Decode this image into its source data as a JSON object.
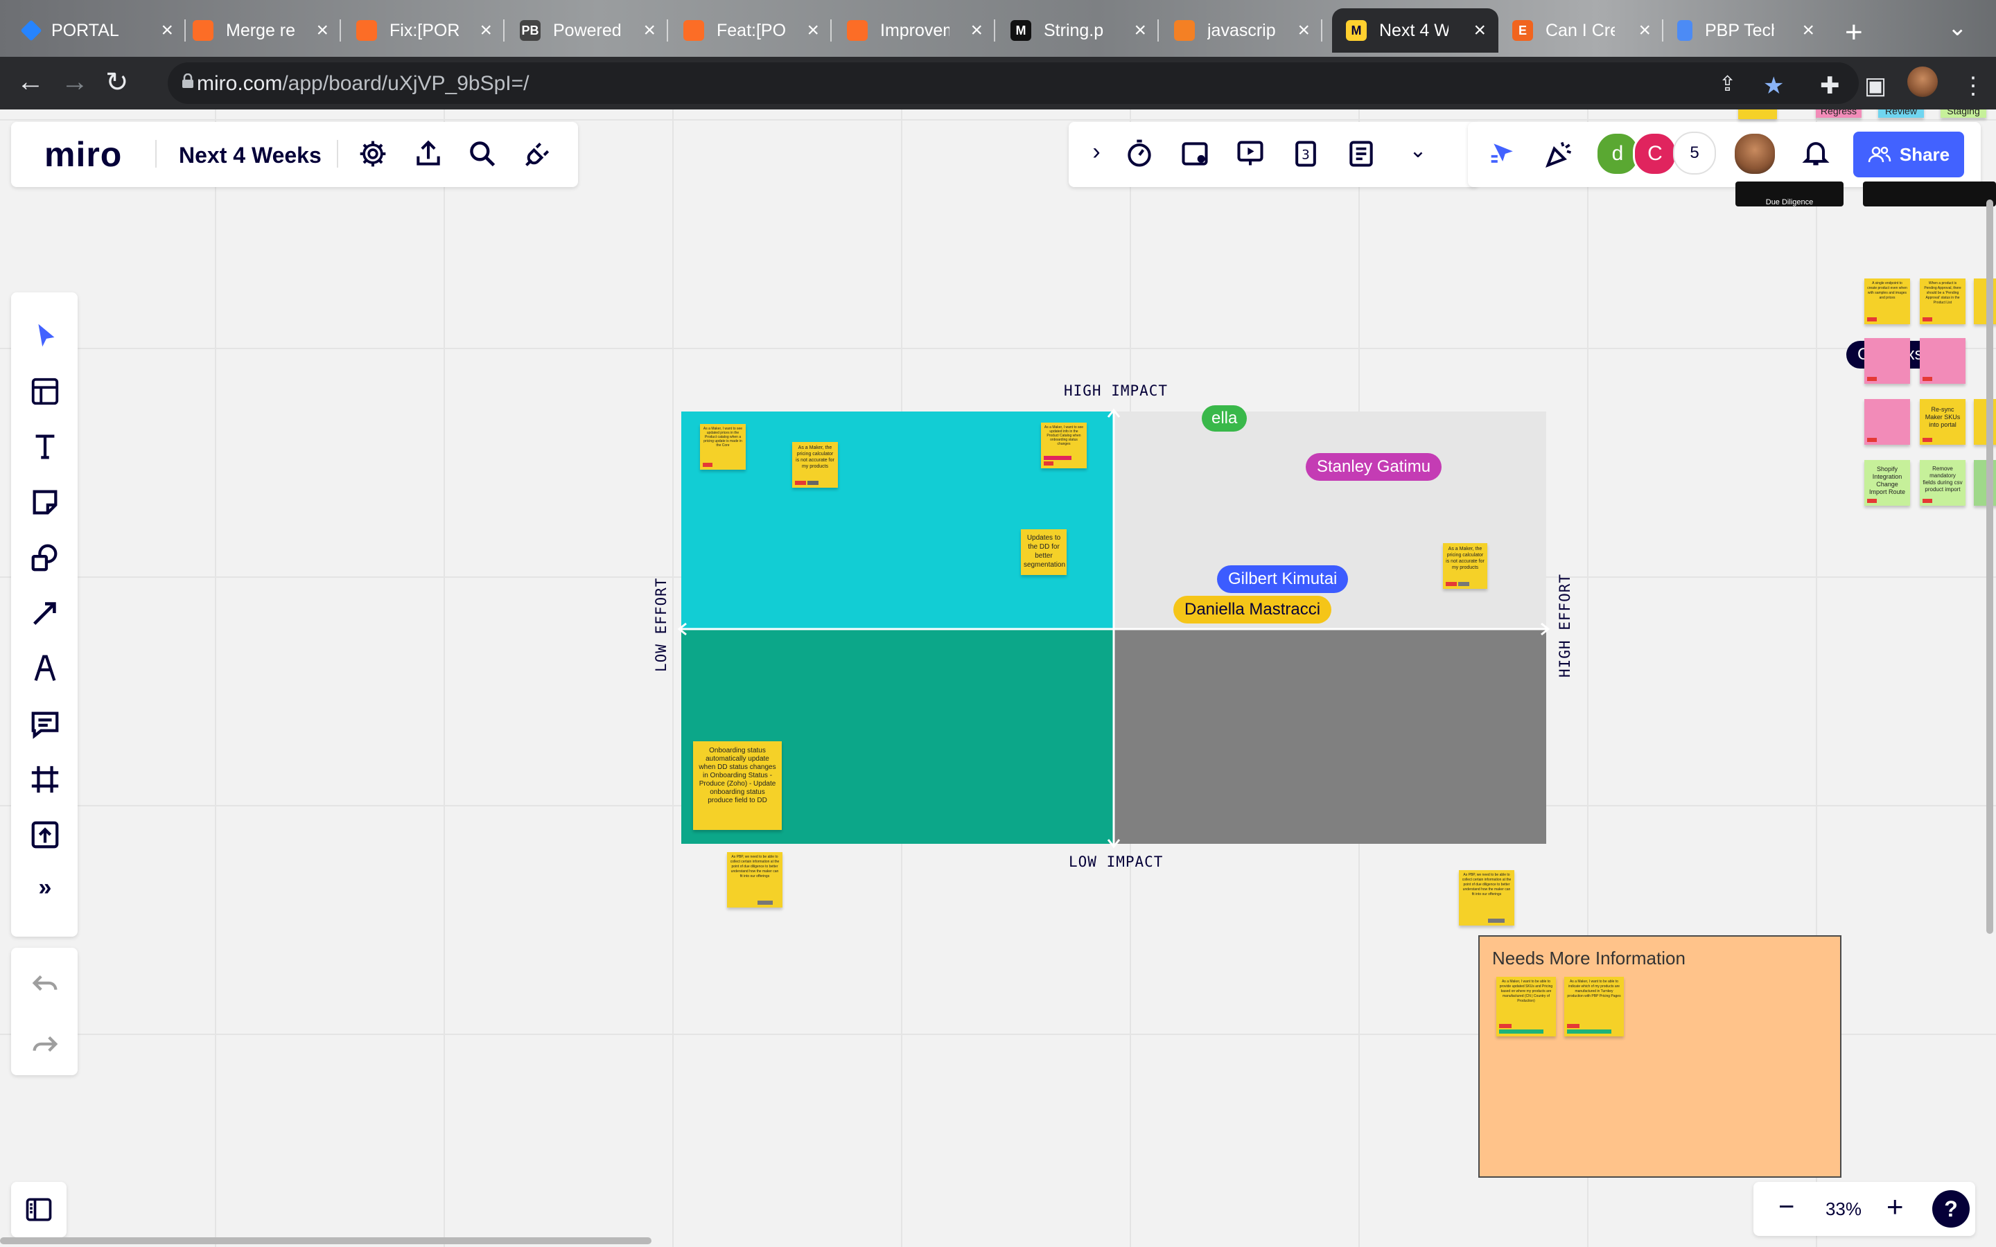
{
  "browser": {
    "tabs": [
      {
        "label": "PORTAL b",
        "icon_color": "#2684ff",
        "icon": "jira-icon"
      },
      {
        "label": "Merge re",
        "icon_color": "#fc6d26",
        "icon": "gitlab-icon"
      },
      {
        "label": "Fix:[POR",
        "icon_color": "#fc6d26",
        "icon": "gitlab-icon"
      },
      {
        "label": "Powered",
        "icon_color": "#444",
        "icon_text": "PB",
        "icon": "productboard-icon"
      },
      {
        "label": "Feat:[PO",
        "icon_color": "#fc6d26",
        "icon": "gitlab-icon"
      },
      {
        "label": "Improvem",
        "icon_color": "#fc6d26",
        "icon": "gitlab-icon"
      },
      {
        "label": "String.p",
        "icon_color": "#111",
        "icon_text": "M",
        "icon": "mdn-icon"
      },
      {
        "label": "javascrip",
        "icon_color": "#f48024",
        "icon": "stackoverflow-icon"
      },
      {
        "label": "Next 4 W",
        "icon_color": "#ffd02f",
        "icon_text": "M",
        "icon": "miro-icon",
        "active": true
      },
      {
        "label": "Can I Cre",
        "icon_color": "#f1641e",
        "icon_text": "E",
        "icon": "etsy-icon"
      },
      {
        "label": "PBP Tech",
        "icon_color": "#4c8bf5",
        "icon": "docs-icon"
      }
    ],
    "url_domain": "miro.com",
    "url_path": "/app/board/uXjVP_9bSpI=/"
  },
  "toolbar": {
    "logo": "miro",
    "board_name": "Next 4 Weeks",
    "collaborator_count": "5",
    "share_label": "Share",
    "collaborators": [
      {
        "initial": "d",
        "color": "#5aa832"
      },
      {
        "initial": "C",
        "color": "#e0245e"
      }
    ]
  },
  "zoom": {
    "level": "33%"
  },
  "matrix": {
    "high_impact": "HIGH IMPACT",
    "low_impact": "LOW IMPACT",
    "low_effort": "LOW EFFORT",
    "high_effort": "HIGH EFFORT",
    "colors": {
      "q1": "#12cdd4",
      "q2": "#e6e6e6",
      "q3": "#0ca789",
      "q4": "#808080"
    },
    "stickies": {
      "s1": "As a Maker, I want to see updated prices in the Product catalog when a pricing update is made in the Core",
      "s2": "As a Maker, the pricing calculator is not accurate for my products",
      "s3": "As a Maker, I want to see updated info in the Product Catalog when onboarding status changes",
      "s4": "Updates to the DD for better segmentation",
      "s5": "Onboarding status automatically update when DD status changes in Onboarding Status - Produce (Zoho) - Update onboarding status produce field to DD",
      "s6": "As PBP, we need to be able to collect certain information at the point of due diligence to better understand how the maker can fit into our offerings",
      "s7": "As a Maker, the pricing calculator is not accurate for my products",
      "s8": "As PBP, we need to be able to collect certain information at the point of due diligence to better understand how the maker can fit into our offerings"
    }
  },
  "cursors": [
    {
      "name": "Stanley Gatimu",
      "color": "#c43cb4"
    },
    {
      "name": "ella",
      "color": "#39b84a"
    },
    {
      "name": "Gilbert Kimutai",
      "color": "#3c5cff"
    },
    {
      "name": "Daniella Mastracci",
      "color": "#f5c518"
    },
    {
      "name": "Carl Fixsen",
      "color": "#050038"
    }
  ],
  "needs_more_info": {
    "title": "Needs More Information",
    "sticky_a": "As a Maker, I want to be able to provide updated SKUs and Pricing based on where my products are manufactured (CN | Country of Production)",
    "sticky_b": "As a Maker, I want to be able to indicate which of my products are manufactured in Turnkey production with PBP Pricing Pages"
  },
  "right_cluster": {
    "top_tags": [
      "Regress",
      "Review",
      "Staging"
    ],
    "due_diligence": "Due Diligence",
    "green1": "Shopify Integration Change Import Route",
    "green2": "Remove mandatory fields during csv product import",
    "yellow1": "Re-sync Maker SKUs into portal",
    "yellow2": "A single endpoint to create product even when with samples and images and prices",
    "yellow3": "When a product is Pending Approval, there should be a 'Pending Approval' status in the Product List"
  }
}
